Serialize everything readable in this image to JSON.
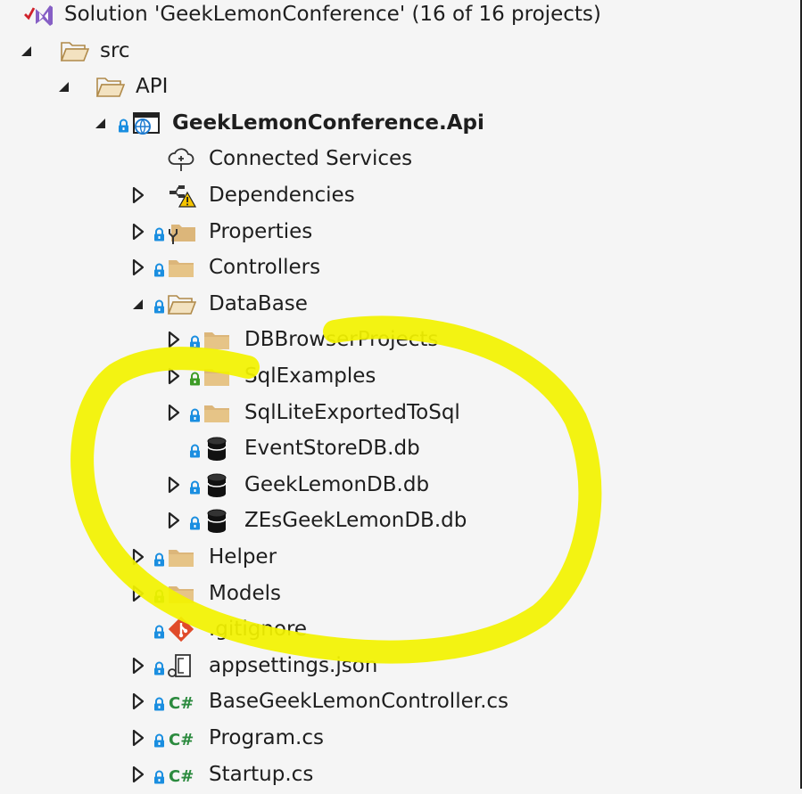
{
  "colors": {
    "folder": "#dcb67a",
    "lock_blue": "#1a8ee0",
    "lock_green": "#3c9b25",
    "csharp": "#2b8a3e",
    "highlight": "#f2f200",
    "git": "#e04b2a",
    "globe": "#1e7bd0"
  },
  "tree": [
    {
      "name": "tree-row-solution",
      "label": "Solution 'GeekLemonConference' (16 of 16 projects)",
      "icon": "visual-studio-solution-icon",
      "arrow": "none",
      "lock": "none",
      "bold": false,
      "depth": 0
    },
    {
      "name": "tree-row-src",
      "label": "src",
      "icon": "folder-open-icon",
      "arrow": "expanded",
      "lock": "none",
      "bold": false,
      "depth": 1
    },
    {
      "name": "tree-row-api",
      "label": "API",
      "icon": "folder-open-icon",
      "arrow": "expanded",
      "lock": "none",
      "bold": false,
      "depth": 2
    },
    {
      "name": "tree-row-project",
      "label": "GeekLemonConference.Api",
      "icon": "web-project-icon",
      "arrow": "expanded",
      "lock": "blue",
      "bold": true,
      "depth": 3
    },
    {
      "name": "tree-row-connected-services",
      "label": "Connected Services",
      "icon": "connected-services-icon",
      "arrow": "none",
      "lock": "none",
      "bold": false,
      "depth": 4
    },
    {
      "name": "tree-row-dependencies",
      "label": "Dependencies",
      "icon": "dependencies-warning-icon",
      "arrow": "collapsed",
      "lock": "none",
      "bold": false,
      "depth": 4
    },
    {
      "name": "tree-row-properties",
      "label": "Properties",
      "icon": "properties-folder-icon",
      "arrow": "collapsed",
      "lock": "blue",
      "bold": false,
      "depth": 4
    },
    {
      "name": "tree-row-controllers",
      "label": "Controllers",
      "icon": "folder-icon",
      "arrow": "collapsed",
      "lock": "blue",
      "bold": false,
      "depth": 4
    },
    {
      "name": "tree-row-database",
      "label": "DataBase",
      "icon": "folder-open-icon",
      "arrow": "expanded",
      "lock": "blue",
      "bold": false,
      "depth": 4
    },
    {
      "name": "tree-row-dbbrowserprojects",
      "label": "DBBrowserProjects",
      "icon": "folder-icon",
      "arrow": "collapsed",
      "lock": "blue",
      "bold": false,
      "depth": 5
    },
    {
      "name": "tree-row-sqlexamples",
      "label": "SqlExamples",
      "icon": "folder-icon",
      "arrow": "collapsed",
      "lock": "green",
      "bold": false,
      "depth": 5
    },
    {
      "name": "tree-row-sqlliteexportedtosql",
      "label": "SqlLiteExportedToSql",
      "icon": "folder-icon",
      "arrow": "collapsed",
      "lock": "blue",
      "bold": false,
      "depth": 5
    },
    {
      "name": "tree-row-eventstoredb",
      "label": "EventStoreDB.db",
      "icon": "database-icon",
      "arrow": "none",
      "lock": "blue",
      "bold": false,
      "depth": 5
    },
    {
      "name": "tree-row-geeklemondb",
      "label": "GeekLemonDB.db",
      "icon": "database-icon",
      "arrow": "collapsed",
      "lock": "blue",
      "bold": false,
      "depth": 5
    },
    {
      "name": "tree-row-zesgeeklemondb",
      "label": "ZEsGeekLemonDB.db",
      "icon": "database-icon",
      "arrow": "collapsed",
      "lock": "blue",
      "bold": false,
      "depth": 5
    },
    {
      "name": "tree-row-helper",
      "label": "Helper",
      "icon": "folder-icon",
      "arrow": "collapsed",
      "lock": "blue",
      "bold": false,
      "depth": 4
    },
    {
      "name": "tree-row-models",
      "label": "Models",
      "icon": "folder-icon",
      "arrow": "collapsed",
      "lock": "green",
      "bold": false,
      "depth": 4
    },
    {
      "name": "tree-row-gitignore",
      "label": ".gitignore",
      "icon": "git-icon",
      "arrow": "none",
      "lock": "blue",
      "bold": false,
      "depth": 4
    },
    {
      "name": "tree-row-appsettings",
      "label": "appsettings.json",
      "icon": "json-file-icon",
      "arrow": "collapsed",
      "lock": "blue",
      "bold": false,
      "depth": 4
    },
    {
      "name": "tree-row-basecontroller",
      "label": "BaseGeekLemonController.cs",
      "icon": "csharp-file-icon",
      "arrow": "collapsed",
      "lock": "blue",
      "bold": false,
      "depth": 4
    },
    {
      "name": "tree-row-program",
      "label": "Program.cs",
      "icon": "csharp-file-icon",
      "arrow": "collapsed",
      "lock": "blue",
      "bold": false,
      "depth": 4
    },
    {
      "name": "tree-row-startup",
      "label": "Startup.cs",
      "icon": "csharp-file-icon",
      "arrow": "collapsed",
      "lock": "blue",
      "bold": false,
      "depth": 4
    }
  ]
}
